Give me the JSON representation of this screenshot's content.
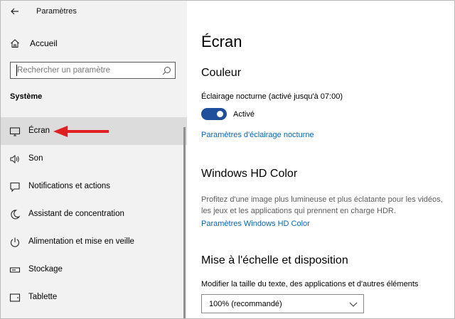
{
  "app_title": "Paramètres",
  "sidebar": {
    "home_label": "Accueil",
    "search_placeholder": "Rechercher un paramètre",
    "section_title": "Système",
    "items": [
      {
        "label": "Écran",
        "icon": "monitor-icon",
        "selected": true
      },
      {
        "label": "Son",
        "icon": "speaker-icon"
      },
      {
        "label": "Notifications et actions",
        "icon": "notification-icon"
      },
      {
        "label": "Assistant de concentration",
        "icon": "moon-icon"
      },
      {
        "label": "Alimentation et mise en veille",
        "icon": "power-icon"
      },
      {
        "label": "Stockage",
        "icon": "storage-icon"
      },
      {
        "label": "Tablette",
        "icon": "tablet-icon"
      }
    ]
  },
  "main": {
    "title": "Écran",
    "color_heading": "Couleur",
    "night_light_label": "Éclairage nocturne (activé jusqu'à 07:00)",
    "night_light_toggle": "Activé",
    "night_light_link": "Paramètres d'éclairage nocturne",
    "hd_heading": "Windows HD Color",
    "hd_desc": "Profitez d'une image plus lumineuse et plus éclatante pour les vidéos, les jeux et les applications qui prennent en charge HDR.",
    "hd_link": "Paramètres Windows HD Color",
    "scale_heading": "Mise à l'échelle et disposition",
    "scale_label": "Modifier la taille du texte, des applications et d'autres éléments",
    "scale_value": "100% (recommandé)"
  },
  "colors": {
    "accent": "#1f4e9a",
    "link": "#0a64b4",
    "annotation_arrow": "#e02020"
  }
}
